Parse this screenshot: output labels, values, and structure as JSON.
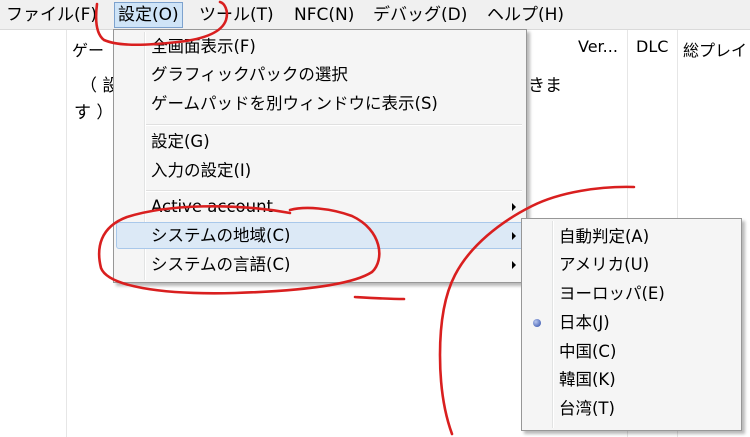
{
  "menubar": {
    "items": [
      {
        "label": "ファイル(F)"
      },
      {
        "label": "設定(O)"
      },
      {
        "label": "ツール(T)"
      },
      {
        "label": "NFC(N)"
      },
      {
        "label": "デバッグ(D)"
      },
      {
        "label": "ヘルプ(H)"
      }
    ]
  },
  "list": {
    "columns": [
      "ゲー",
      "Ver...",
      "DLC",
      "総プレイ"
    ],
    "empty_line1_left": "（ 設",
    "empty_line1_right": "きま",
    "empty_line2": "す ）"
  },
  "settings_menu": {
    "fullscreen": "全画面表示(F)",
    "graphics_pack": "グラフィックパックの選択",
    "gamepad_window": "ゲームパッドを別ウィンドウに表示(S)",
    "settings": "設定(G)",
    "input_settings": "入力の設定(I)",
    "active_account": "Active account",
    "system_region": "システムの地域(C)",
    "system_language": "システムの言語(C)"
  },
  "region_submenu": {
    "items": [
      {
        "label": "自動判定(A)"
      },
      {
        "label": "アメリカ(U)"
      },
      {
        "label": "ヨーロッパ(E)"
      },
      {
        "label": "日本(J)"
      },
      {
        "label": "中国(C)"
      },
      {
        "label": "韓国(K)"
      },
      {
        "label": "台湾(T)"
      }
    ],
    "selected": "日本(J)"
  },
  "colors": {
    "annotation": "#d91f1f",
    "highlight": "#dce9f6",
    "menu_bg": "#f5f5f5"
  }
}
